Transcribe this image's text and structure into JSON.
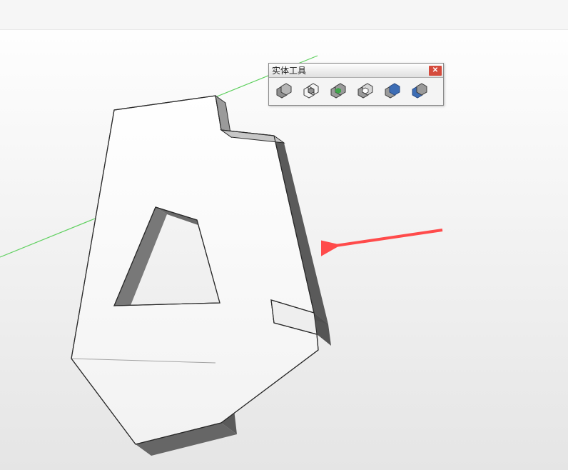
{
  "toolbar": {
    "title": "实体工具",
    "close_label": "✕",
    "tools": [
      {
        "name": "outer-shell",
        "id": "outer-shell-icon"
      },
      {
        "name": "intersect",
        "id": "intersect-icon"
      },
      {
        "name": "union",
        "id": "union-icon"
      },
      {
        "name": "subtract",
        "id": "subtract-icon"
      },
      {
        "name": "trim",
        "id": "trim-icon"
      },
      {
        "name": "split",
        "id": "split-icon"
      }
    ]
  },
  "scene": {
    "description": "3D angular letter-like shape resembling stylized A/CCTV building form",
    "ground_color": "#e5e5e5",
    "axis_color_green": "#3fbf3f"
  },
  "annotation": {
    "type": "arrow",
    "color": "#ff4b4b"
  }
}
